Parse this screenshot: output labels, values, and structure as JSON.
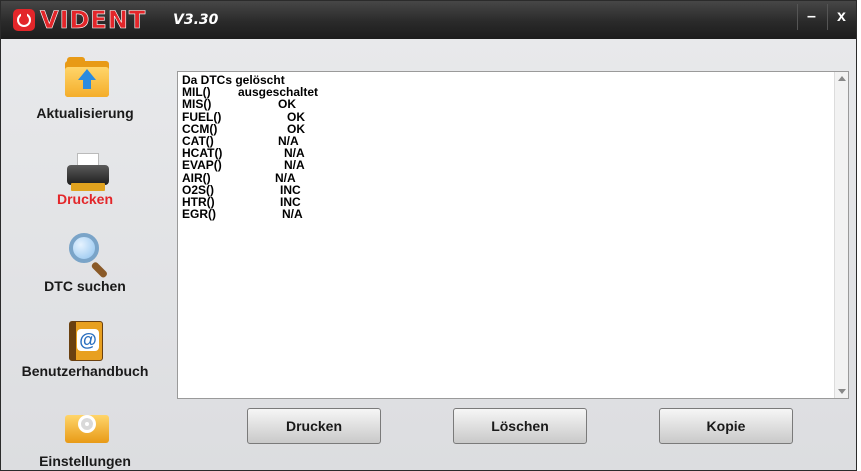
{
  "app": {
    "logo_text": "VIDENT",
    "version": "V3.30",
    "minimize_label": "–",
    "close_label": "x",
    "accent_color": "#e3262a"
  },
  "sidebar": {
    "items": [
      {
        "label": "Aktualisierung",
        "icon": "update-folder-icon",
        "active": false
      },
      {
        "label": "Drucken",
        "icon": "printer-icon",
        "active": true
      },
      {
        "label": "DTC suchen",
        "icon": "magnifier-icon",
        "active": false
      },
      {
        "label": "Benutzerhandbuch",
        "icon": "manual-book-icon",
        "active": false
      },
      {
        "label": "Einstellungen",
        "icon": "settings-gear-icon",
        "active": false
      }
    ]
  },
  "report": {
    "header": "Da DTCs gelöscht",
    "rows": [
      {
        "key": "MIL()",
        "value": "ausgeschaltet"
      },
      {
        "key": "MIS()",
        "value": "OK"
      },
      {
        "key": "FUEL()",
        "value": "OK"
      },
      {
        "key": "CCM()",
        "value": "OK"
      },
      {
        "key": "CAT()",
        "value": "N/A"
      },
      {
        "key": "HCAT()",
        "value": "N/A"
      },
      {
        "key": "EVAP()",
        "value": "N/A"
      },
      {
        "key": "AIR()",
        "value": "N/A"
      },
      {
        "key": "O2S()",
        "value": "INC"
      },
      {
        "key": "HTR()",
        "value": "INC"
      },
      {
        "key": "EGR()",
        "value": "N/A"
      }
    ]
  },
  "actions": {
    "print_label": "Drucken",
    "delete_label": "Löschen",
    "copy_label": "Kopie"
  }
}
